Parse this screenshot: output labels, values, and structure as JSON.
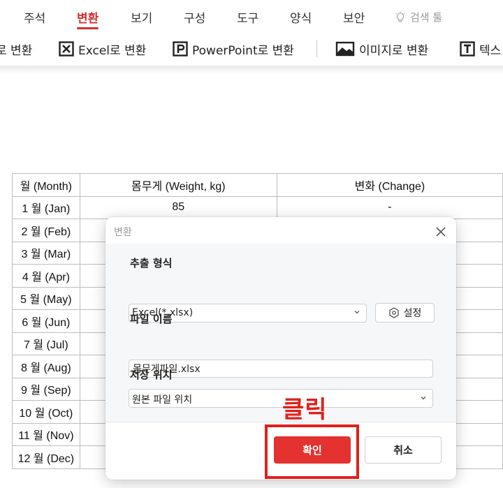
{
  "menu": {
    "tabs": [
      {
        "label": "주석"
      },
      {
        "label": "변환"
      },
      {
        "label": "보기"
      },
      {
        "label": "구성"
      },
      {
        "label": "도구"
      },
      {
        "label": "양식"
      },
      {
        "label": "보안"
      }
    ],
    "active_tab": "변환",
    "search_tool_label": "검색 툴",
    "accent_color": "#d32f2f"
  },
  "toolbar": {
    "buttons": [
      {
        "label": "로 변환",
        "icon": "word-icon"
      },
      {
        "label": "Excel로 변환",
        "icon": "excel-icon"
      },
      {
        "label": "PowerPoint로 변환",
        "icon": "powerpoint-icon"
      },
      {
        "label": "이미지로 변환",
        "icon": "image-icon"
      },
      {
        "label": "텍스",
        "icon": "text-icon"
      }
    ]
  },
  "document_table": {
    "headers": [
      "월 (Month)",
      "몸무게 (Weight, kg)",
      "변화 (Change)"
    ],
    "rows": [
      [
        "1 월 (Jan)",
        "85",
        "-"
      ],
      [
        "2 월 (Feb)",
        "",
        ""
      ],
      [
        "3 월 (Mar)",
        "",
        ""
      ],
      [
        "4 월 (Apr)",
        "",
        ""
      ],
      [
        "5 월 (May)",
        "",
        ""
      ],
      [
        "6 월 (Jun)",
        "",
        ""
      ],
      [
        "7 월 (Jul)",
        "",
        ""
      ],
      [
        "8 월 (Aug)",
        "",
        ""
      ],
      [
        "9 월 (Sep)",
        "",
        ""
      ],
      [
        "10 월 (Oct)",
        "",
        ""
      ],
      [
        "11 월 (Nov)",
        "",
        ""
      ],
      [
        "12 월 (Dec)",
        "",
        ""
      ]
    ]
  },
  "dialog": {
    "title": "변환",
    "format_label": "추출 형식",
    "format_value": "Excel(*.xlsx)",
    "settings_label": "설정",
    "filename_label": "파일 이름",
    "filename_value": "몸무게파일.xlsx",
    "location_label": "저장 위치",
    "location_value": "원본 파일 위치",
    "ok_label": "확인",
    "cancel_label": "취소",
    "ok_color": "#e3322f"
  },
  "annotation": {
    "text": "클릭",
    "color": "#e0201b"
  }
}
